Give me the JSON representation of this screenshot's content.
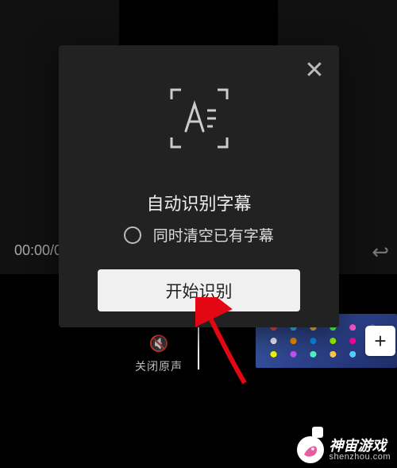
{
  "preview": {
    "timecode": "00:00/0"
  },
  "icons": {
    "undo": "↩",
    "close": "✕",
    "plus": "+",
    "sound_off": "🔇"
  },
  "timeline": {
    "sound_off_label": "关闭原声"
  },
  "modal": {
    "title": "自动识别字幕",
    "option_label": "同时清空已有字幕",
    "start_button": "开始识别"
  },
  "watermark": {
    "title": "神宙游戏",
    "subtitle": "shenzhou.com"
  }
}
